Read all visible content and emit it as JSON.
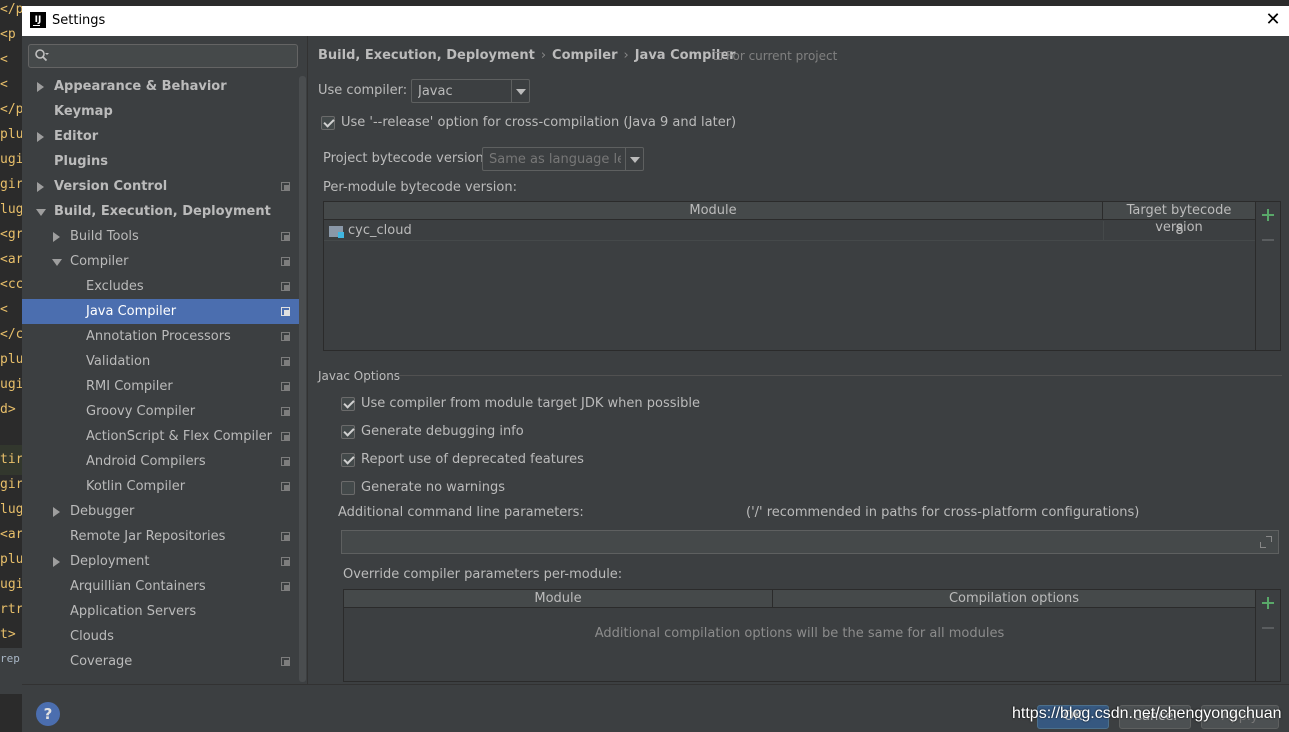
{
  "editor": {
    "lines": [
      "</p",
      "<p",
      " <",
      " <",
      "</p",
      "plu",
      "ugi",
      "gir",
      "lug",
      "<gr",
      "<ar",
      "<cc",
      " <",
      "</c",
      "plu",
      "ugi",
      "d>",
      "",
      "tir",
      "gir",
      "lug",
      "<ar",
      "plu",
      "ugi",
      "rtr",
      "t>",
      "rep"
    ]
  },
  "window": {
    "title": "Settings",
    "app_icon_text": "IJ"
  },
  "sidebar": {
    "search_placeholder": "",
    "items": [
      {
        "label": "Appearance & Behavior"
      },
      {
        "label": "Keymap"
      },
      {
        "label": "Editor"
      },
      {
        "label": "Plugins"
      },
      {
        "label": "Version Control"
      },
      {
        "label": "Build, Execution, Deployment"
      },
      {
        "label": "Build Tools"
      },
      {
        "label": "Compiler"
      },
      {
        "label": "Excludes"
      },
      {
        "label": "Java Compiler"
      },
      {
        "label": "Annotation Processors"
      },
      {
        "label": "Validation"
      },
      {
        "label": "RMI Compiler"
      },
      {
        "label": "Groovy Compiler"
      },
      {
        "label": "ActionScript & Flex Compiler"
      },
      {
        "label": "Android Compilers"
      },
      {
        "label": "Kotlin Compiler"
      },
      {
        "label": "Debugger"
      },
      {
        "label": "Remote Jar Repositories"
      },
      {
        "label": "Deployment"
      },
      {
        "label": "Arquillian Containers"
      },
      {
        "label": "Application Servers"
      },
      {
        "label": "Clouds"
      },
      {
        "label": "Coverage"
      }
    ]
  },
  "main": {
    "breadcrumb": [
      "Build, Execution, Deployment",
      "Compiler",
      "Java Compiler"
    ],
    "breadcrumb_sep": "›",
    "for_project": "For current project",
    "use_compiler_label": "Use compiler:",
    "use_compiler_value": "Javac",
    "release_option_label": "Use '--release' option for cross-compilation (Java 9 and later)",
    "project_bytecode_label": "Project bytecode version:",
    "project_bytecode_value": "Same as language level",
    "per_module_label": "Per-module bytecode version:",
    "module_table": {
      "headers": [
        "Module",
        "Target bytecode version"
      ],
      "rows": [
        {
          "module": "cyc_cloud",
          "version": "8"
        }
      ]
    },
    "javac_options_title": "Javac Options",
    "options": [
      {
        "label": "Use compiler from module target JDK when possible",
        "checked": true
      },
      {
        "label": "Generate debugging info",
        "checked": true
      },
      {
        "label": "Report use of deprecated features",
        "checked": true
      },
      {
        "label": "Generate no warnings",
        "checked": false
      }
    ],
    "cmdline_label": "Additional command line parameters:",
    "cmdline_hint": "('/' recommended in paths for cross-platform configurations)",
    "cmdline_value": "",
    "override_label": "Override compiler parameters per-module:",
    "override_table": {
      "headers": [
        "Module",
        "Compilation options"
      ],
      "empty_text": "Additional compilation options will be the same for all modules"
    }
  },
  "bottom": {
    "help": "?",
    "ok": "OK",
    "cancel": "Cancel",
    "apply": "Apply",
    "watermark": "https://blog.csdn.net/chengyongchuan"
  },
  "colors": {
    "accent": "#4b6eaf",
    "add": "#59a869",
    "background": "#3c3f41"
  }
}
